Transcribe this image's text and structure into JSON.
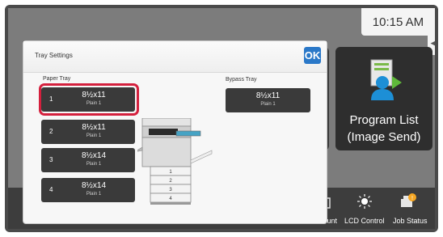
{
  "status": {
    "time": "10:15 AM"
  },
  "home": {
    "program_list_label": "Program List\n(Image Send)",
    "bottom_items": [
      "Count",
      "LCD Control",
      "Job Status"
    ]
  },
  "dialog": {
    "title": "Tray Settings",
    "ok_label": "OK",
    "paper_tray_label": "Paper Tray",
    "bypass_tray_label": "Bypass Tray",
    "trays": [
      {
        "number": "1",
        "size": "8½x11",
        "type": "Plain 1"
      },
      {
        "number": "2",
        "size": "8½x11",
        "type": "Plain 1"
      },
      {
        "number": "3",
        "size": "8½x14",
        "type": "Plain 1"
      },
      {
        "number": "4",
        "size": "8½x14",
        "type": "Plain 1"
      }
    ],
    "bypass": {
      "size": "8½x11",
      "type": "Plain 1"
    },
    "drawer_labels": [
      "1",
      "2",
      "3",
      "4"
    ]
  },
  "colors": {
    "highlight": "#d4203d",
    "ok_button": "#2a78c8"
  }
}
